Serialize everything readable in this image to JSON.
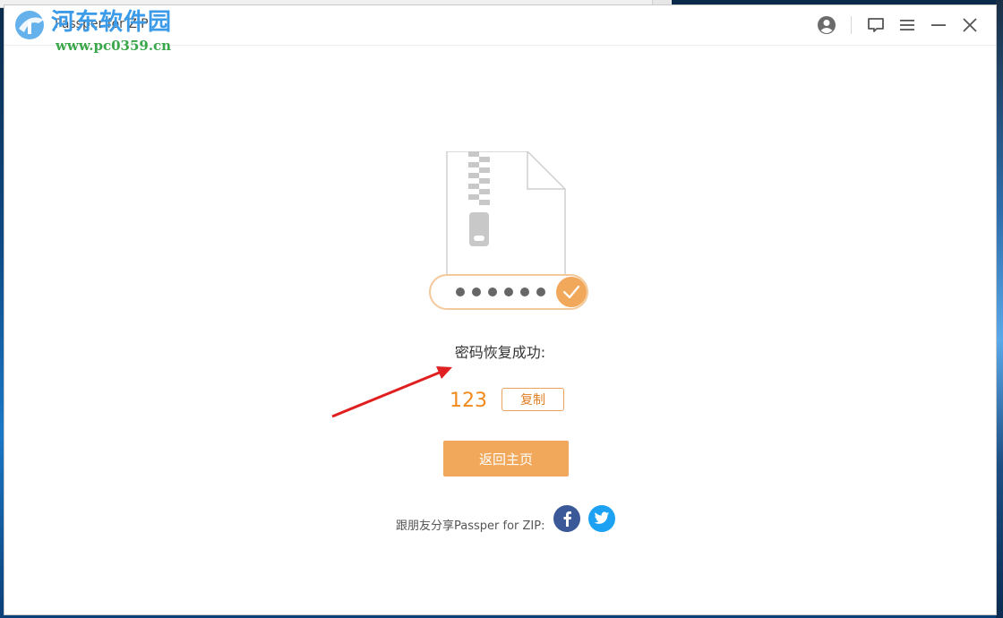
{
  "window": {
    "title": "Passper for ZIP",
    "watermark_name": "河东软件园",
    "watermark_url": "www.pc0359.cn"
  },
  "titlebar_icons": [
    "user-icon",
    "feedback-icon",
    "menu-icon",
    "minimize-icon",
    "close-icon"
  ],
  "result": {
    "success_message": "密码恢复成功:",
    "password": "123",
    "copy_label": "复制",
    "home_label": "返回主页"
  },
  "share": {
    "label": "跟朋友分享Passper for ZIP:",
    "networks": [
      "facebook-icon",
      "twitter-icon"
    ]
  },
  "colors": {
    "accent": "#f2a85b",
    "password_color": "#f08a1c",
    "facebook": "#3b5998",
    "twitter": "#1da1f2",
    "arrow": "#e02020"
  }
}
